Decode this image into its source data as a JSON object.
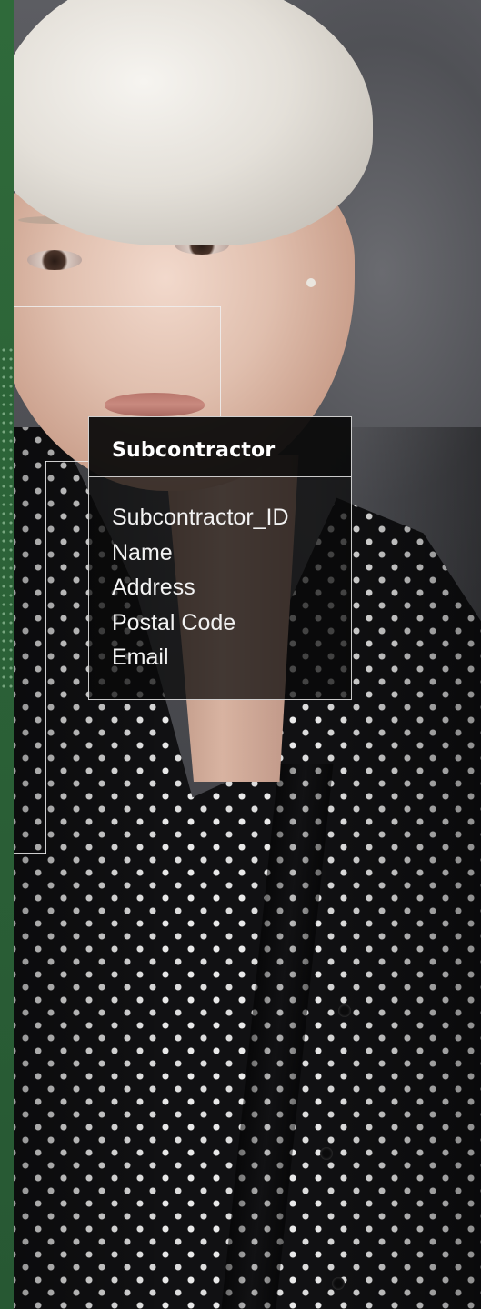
{
  "entity": {
    "title": "Subcontractor",
    "fields": [
      {
        "label": "Subcontractor_ID"
      },
      {
        "label": "Name"
      },
      {
        "label": "Address"
      },
      {
        "label": "Postal Code"
      },
      {
        "label": "Email"
      }
    ]
  },
  "colors": {
    "accent_strip": "#2f6a3a",
    "line": "#f0f0f0",
    "card_background": "#080809"
  }
}
